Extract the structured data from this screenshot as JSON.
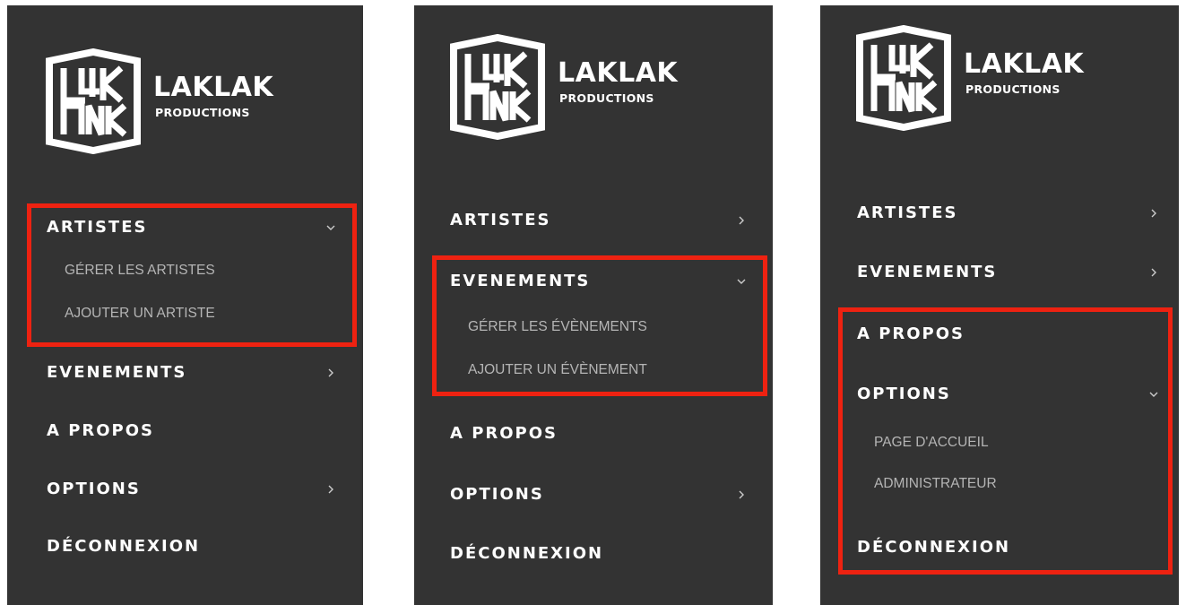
{
  "brand": {
    "name": "LAKLAK",
    "sub": "PRODUCTIONS",
    "mark": "L4K NK"
  },
  "colors": {
    "panel": "#333333",
    "highlight": "#ee2211",
    "submenu": "#b5b5b5"
  },
  "icons": {
    "collapsed": "chevron-right-icon",
    "expanded": "chevron-down-icon"
  },
  "panels": [
    {
      "artistes": "ARTISTES",
      "artistes_sub": [
        "GÉRER LES ARTISTES",
        "AJOUTER UN ARTISTE"
      ],
      "evenements": "EVENEMENTS",
      "apropos": "A PROPOS",
      "options": "OPTIONS",
      "deconnexion": "DÉCONNEXION"
    },
    {
      "artistes": "ARTISTES",
      "evenements": "EVENEMENTS",
      "evenements_sub": [
        "GÉRER LES ÉVÈNEMENTS",
        "AJOUTER UN ÉVÈNEMENT"
      ],
      "apropos": "A PROPOS",
      "options": "OPTIONS",
      "deconnexion": "DÉCONNEXION"
    },
    {
      "artistes": "ARTISTES",
      "evenements": "EVENEMENTS",
      "apropos": "A PROPOS",
      "options": "OPTIONS",
      "options_sub": [
        "PAGE D'ACCUEIL",
        "ADMINISTRATEUR"
      ],
      "deconnexion": "DÉCONNEXION"
    }
  ]
}
